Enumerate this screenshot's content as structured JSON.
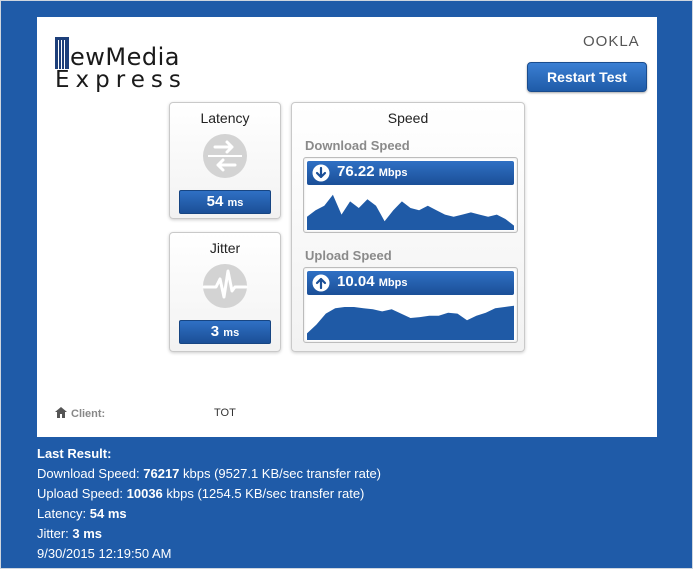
{
  "brand": {
    "logo_line1": "ewMedia",
    "logo_line2": "Express",
    "provider": "OOKLA"
  },
  "actions": {
    "restart_label": "Restart Test"
  },
  "latency": {
    "title": "Latency",
    "value": "54",
    "unit": "ms",
    "icon": "latency-arrows-icon"
  },
  "jitter": {
    "title": "Jitter",
    "value": "3",
    "unit": "ms",
    "icon": "jitter-pulse-icon"
  },
  "speed": {
    "title": "Speed",
    "download": {
      "label": "Download Speed",
      "value": "76.22",
      "unit": "Mbps",
      "graph": [
        0.3,
        0.45,
        0.55,
        0.8,
        0.35,
        0.65,
        0.5,
        0.7,
        0.55,
        0.2,
        0.45,
        0.65,
        0.5,
        0.45,
        0.55,
        0.45,
        0.35,
        0.3,
        0.35,
        0.4,
        0.35,
        0.3,
        0.35,
        0.25,
        0.1
      ]
    },
    "upload": {
      "label": "Upload Speed",
      "value": "10.04",
      "unit": "Mbps",
      "graph": [
        0.15,
        0.35,
        0.6,
        0.72,
        0.75,
        0.75,
        0.72,
        0.7,
        0.65,
        0.7,
        0.6,
        0.5,
        0.52,
        0.55,
        0.55,
        0.62,
        0.6,
        0.45,
        0.55,
        0.62,
        0.72,
        0.75,
        0.78
      ]
    }
  },
  "client": {
    "label": "Client:",
    "value": "TOT"
  },
  "results": {
    "heading": "Last Result:",
    "download_label": "Download Speed: ",
    "download_kbps": "76217",
    "download_rest": " kbps (9527.1 KB/sec transfer rate)",
    "upload_label": "Upload Speed: ",
    "upload_kbps": "10036",
    "upload_rest": " kbps (1254.5 KB/sec transfer rate)",
    "latency_label": "Latency: ",
    "latency_value": "54 ms",
    "jitter_label": "Jitter: ",
    "jitter_value": "3 ms",
    "timestamp": "9/30/2015 12:19:50 AM"
  },
  "colors": {
    "background": "#1f5ba8",
    "accent": "#1b4f97",
    "graph_fill": "#1f5aa6"
  }
}
